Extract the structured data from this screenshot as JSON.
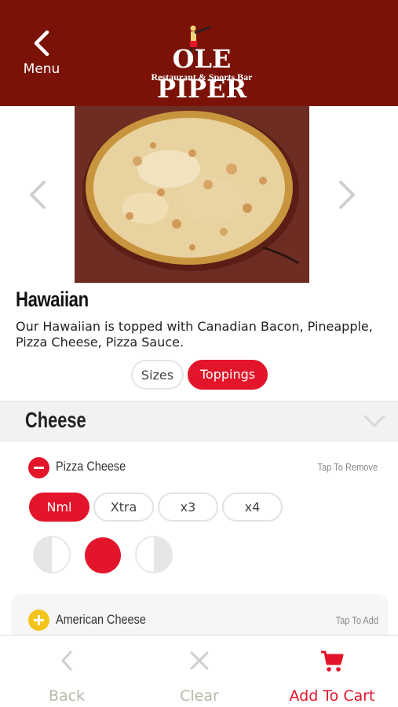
{
  "header": {
    "back_label": "Menu",
    "logo_name": "OLE PIPER",
    "logo_sub": "Restaurant & Sports Bar"
  },
  "item": {
    "name": "Hawaiian",
    "description": "Our Hawaiian is topped with Canadian Bacon, Pineapple, Pizza Cheese, Pizza Sauce."
  },
  "tabs": [
    {
      "label": "Sizes",
      "selected": false
    },
    {
      "label": "Toppings",
      "selected": true
    }
  ],
  "category": {
    "title": "Cheese",
    "icon": "chevron-down-icon"
  },
  "toppings": [
    {
      "name": "Pizza Cheese",
      "hint": "Tap To Remove",
      "added": true,
      "amounts": [
        "Nml",
        "Xtra",
        "x3",
        "x4"
      ],
      "selected_amount": "Nml",
      "placement": "whole"
    },
    {
      "name": "American Cheese",
      "hint": "Tap To Add",
      "added": false
    }
  ],
  "footer": {
    "back_label": "Back",
    "clear_label": "Clear",
    "cart_label": "Add To Cart"
  },
  "colors": {
    "header_bg": "#7a1207",
    "accent": "#e3152a",
    "add_icon": "#f3c41b"
  }
}
